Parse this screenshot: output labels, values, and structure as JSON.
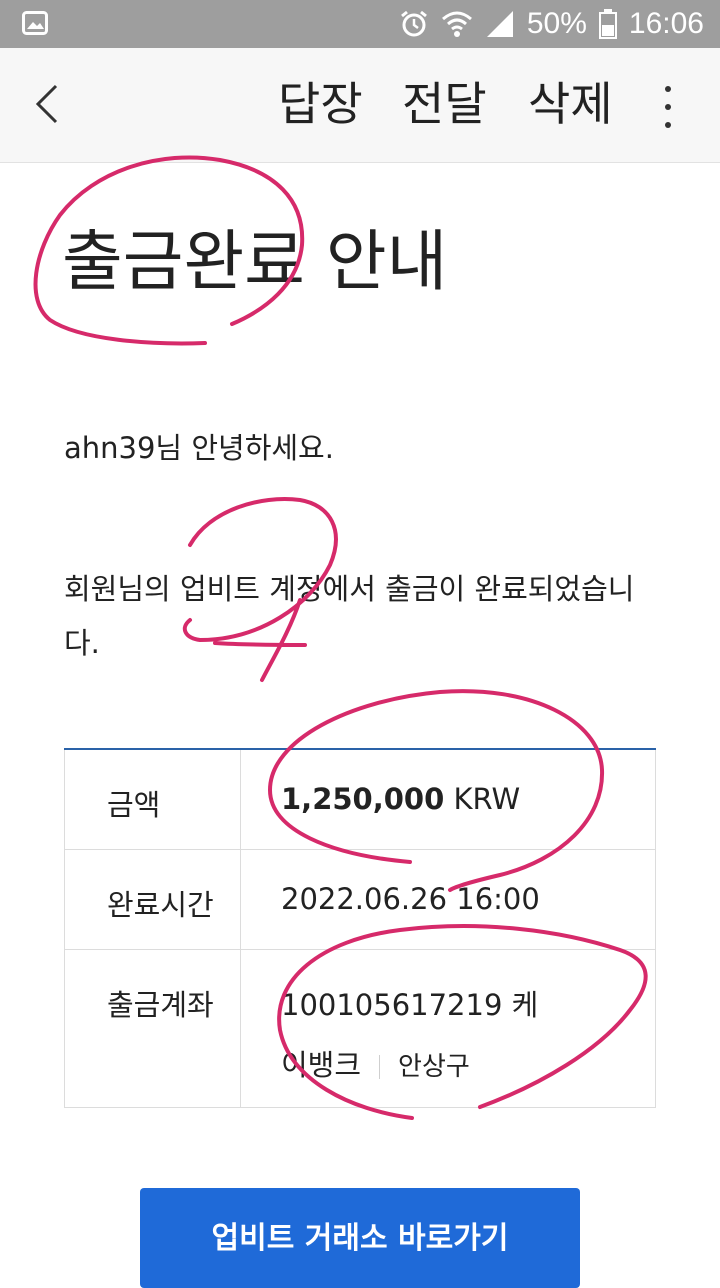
{
  "status_bar": {
    "battery": "50%",
    "time": "16:06"
  },
  "app_bar": {
    "reply_label": "답장",
    "forward_label": "전달",
    "delete_label": "삭제"
  },
  "email": {
    "title": "출금완료 안내",
    "greeting": "ahn39님 안녕하세요.",
    "message": "회원님의 업비트 계정에서 출금이 완료되었습니다.",
    "table": {
      "amount_label": "금액",
      "amount_value": "1,250,000",
      "amount_unit": "KRW",
      "time_label": "완료시간",
      "time_value": "2022.06.26 16:00",
      "account_label": "출금계좌",
      "account_number": "100105617219 케",
      "bank_name_rest": "이뱅크",
      "account_holder": "안상구"
    },
    "cta_label": "업비트 거래소 바로가기"
  },
  "colors": {
    "status_bar_bg": "#9e9e9e",
    "app_bar_bg": "#f7f7f7",
    "table_top_border": "#2a62a8",
    "cta_bg": "#1f6ad8",
    "annotation": "#d62a6a"
  }
}
